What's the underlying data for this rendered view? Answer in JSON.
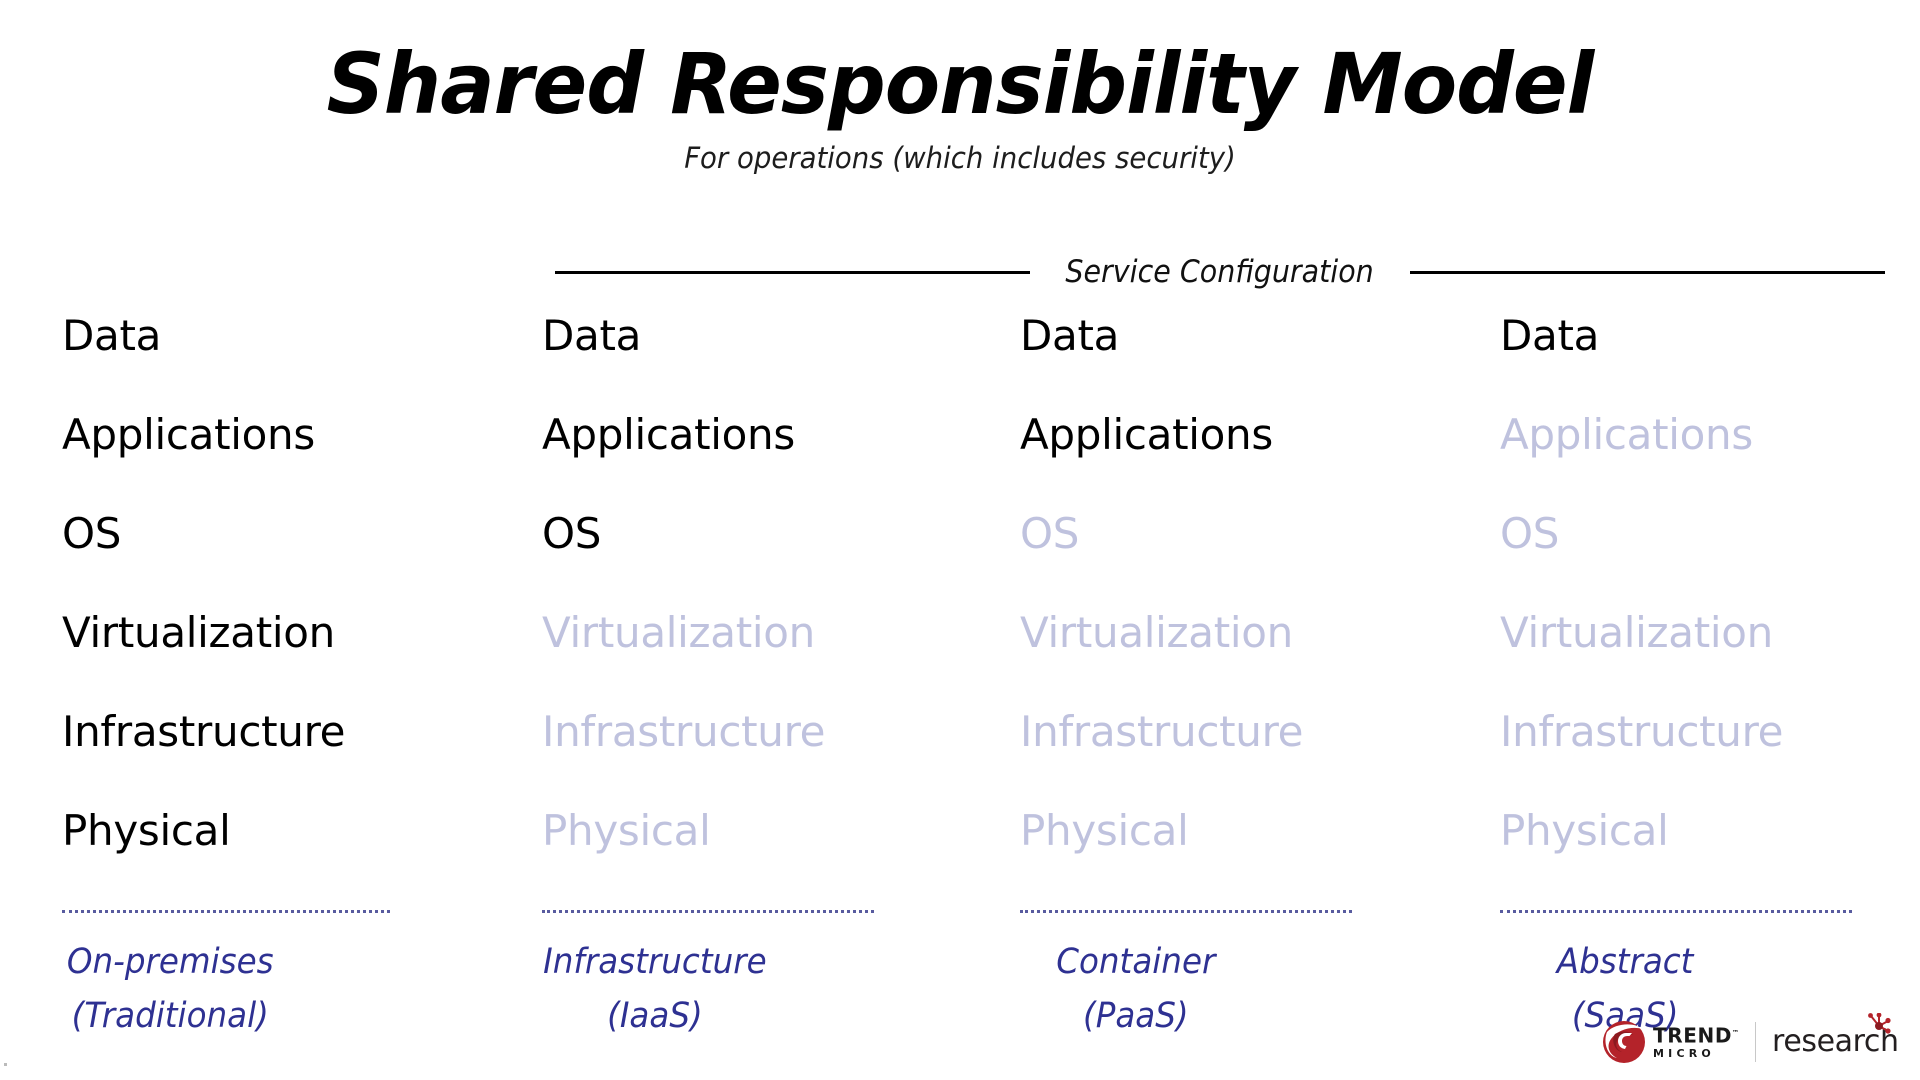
{
  "slide": {
    "title": "Shared Responsibility Model",
    "subtitle": "For operations (which includes security)",
    "band_label": "Service Configuration"
  },
  "colors": {
    "active_text": "#000000",
    "dimmed_text": "#bfc2de",
    "caption": "#2e3192",
    "dotted_rule": "#3b3f8f",
    "brand_red": "#b4232a",
    "background": "#ffffff"
  },
  "layers": [
    "Data",
    "Applications",
    "OS",
    "Virtualization",
    "Infrastructure",
    "Physical"
  ],
  "columns": [
    {
      "id": "on-premises",
      "caption_line1": "On-premises",
      "caption_line2": "(Traditional)",
      "rows": [
        {
          "label": "Data",
          "state": "active"
        },
        {
          "label": "Applications",
          "state": "active"
        },
        {
          "label": "OS",
          "state": "active"
        },
        {
          "label": "Virtualization",
          "state": "active"
        },
        {
          "label": "Infrastructure",
          "state": "active"
        },
        {
          "label": "Physical",
          "state": "active"
        }
      ]
    },
    {
      "id": "infrastructure-iaas",
      "caption_line1": "Infrastructure",
      "caption_line2": "(IaaS)",
      "rows": [
        {
          "label": "Data",
          "state": "active"
        },
        {
          "label": "Applications",
          "state": "active"
        },
        {
          "label": "OS",
          "state": "active"
        },
        {
          "label": "Virtualization",
          "state": "dimmed"
        },
        {
          "label": "Infrastructure",
          "state": "dimmed"
        },
        {
          "label": "Physical",
          "state": "dimmed"
        }
      ]
    },
    {
      "id": "container-paas",
      "caption_line1": "Container",
      "caption_line2": "(PaaS)",
      "rows": [
        {
          "label": "Data",
          "state": "active"
        },
        {
          "label": "Applications",
          "state": "active"
        },
        {
          "label": "OS",
          "state": "dimmed"
        },
        {
          "label": "Virtualization",
          "state": "dimmed"
        },
        {
          "label": "Infrastructure",
          "state": "dimmed"
        },
        {
          "label": "Physical",
          "state": "dimmed"
        }
      ]
    },
    {
      "id": "abstract-saas",
      "caption_line1": "Abstract",
      "caption_line2": "(SaaS)",
      "rows": [
        {
          "label": "Data",
          "state": "active"
        },
        {
          "label": "Applications",
          "state": "dimmed"
        },
        {
          "label": "OS",
          "state": "dimmed"
        },
        {
          "label": "Virtualization",
          "state": "dimmed"
        },
        {
          "label": "Infrastructure",
          "state": "dimmed"
        },
        {
          "label": "Physical",
          "state": "dimmed"
        }
      ]
    }
  ],
  "logo": {
    "brand_line1": "TREND",
    "brand_line2": "MICRO",
    "trademark": "™",
    "secondary": "research"
  }
}
